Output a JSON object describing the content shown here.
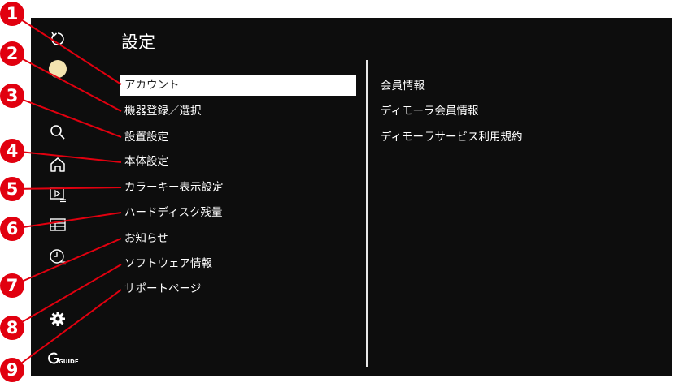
{
  "page": {
    "title": "設定"
  },
  "rail": {
    "icons": [
      "refresh-icon",
      "avatar",
      "search-icon",
      "home-icon",
      "video-list-icon",
      "guide-list-icon",
      "clock-list-icon",
      "gear-icon"
    ],
    "guide_logo": "GUIDE"
  },
  "menu": {
    "items": [
      {
        "label": "アカウント",
        "selected": true
      },
      {
        "label": "機器登録／選択"
      },
      {
        "label": "設置設定"
      },
      {
        "label": "本体設定"
      },
      {
        "label": "カラーキー表示設定"
      },
      {
        "label": "ハードディスク残量"
      },
      {
        "label": "お知らせ"
      },
      {
        "label": "ソフトウェア情報"
      },
      {
        "label": "サポートページ"
      }
    ]
  },
  "submenu": {
    "items": [
      "会員情報",
      "ディモーラ会員情報",
      "ディモーラサービス利用規約"
    ]
  },
  "callouts": [
    "1",
    "2",
    "3",
    "4",
    "5",
    "6",
    "7",
    "8",
    "9"
  ],
  "colors": {
    "screen_bg": "#0d0d0d",
    "callout": "#e1000f",
    "selected_bg": "#ffffff",
    "text": "#ffffff"
  }
}
